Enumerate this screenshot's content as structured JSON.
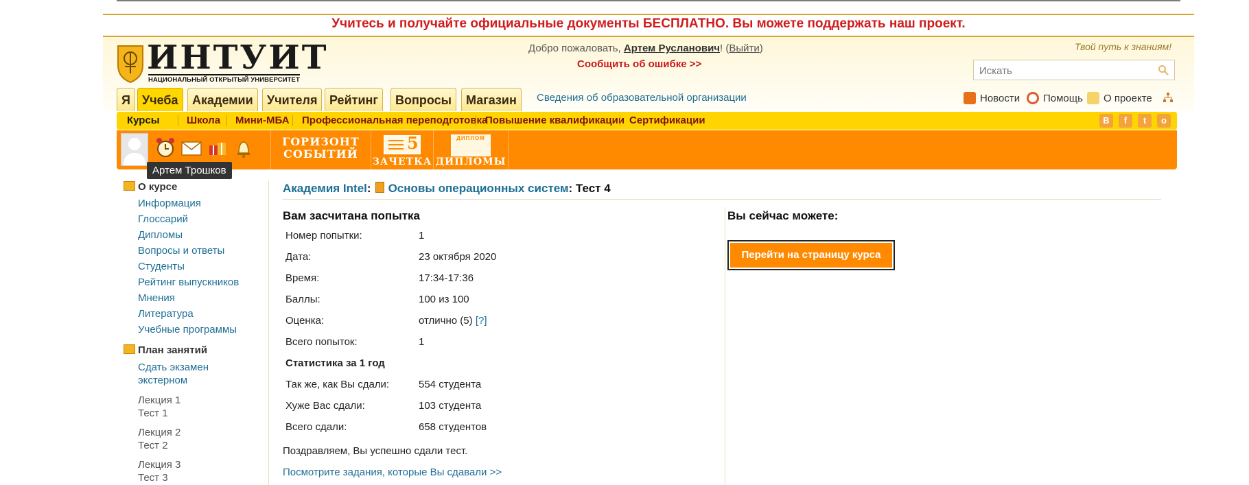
{
  "banner": "Учитесь и получайте официальные документы БЕСПЛАТНО. Вы можете поддержать наш проект.",
  "logo": {
    "title": "ИНТУИТ",
    "subtitle": "НАЦИОНАЛЬНЫЙ ОТКРЫТЫЙ УНИВЕРСИТЕТ"
  },
  "header": {
    "welcome_prefix": "Добро пожаловать,",
    "user_name": "Артем Русланович",
    "excl": "!",
    "logout_label": "Выйти",
    "report_error": "Сообщить об ошибке >>",
    "slogan": "Твой путь к знаниям!",
    "search_placeholder": "Искать"
  },
  "tabs": [
    "Я",
    "Учеба",
    "Академии",
    "Учителя",
    "Рейтинг",
    "Вопросы",
    "Магазин"
  ],
  "active_tab": "Учеба",
  "org_info_link": "Сведения об образовательной организации",
  "top_links": {
    "news": "Новости",
    "help": "Помощь",
    "about": "О проекте"
  },
  "submenu": [
    "Курсы",
    "Школа",
    "Мини-МБА",
    "Профессиональная переподготовка",
    "Повышение квалификации",
    "Сертификации"
  ],
  "social": [
    "В",
    "f",
    "t",
    "о"
  ],
  "promo": {
    "events_line1": "ГОРИЗОНТ",
    "events_line2": "СОБЫТИЙ",
    "gradebook": "ЗАЧЕТКА",
    "gradebook_num": "5",
    "diplomas": "ДИПЛОМЫ",
    "diploma_tag": "ДИПЛОМ"
  },
  "tooltip": "Артем Трошков",
  "sidebar": {
    "about_heading": "О курсе",
    "about_links": [
      "Информация",
      "Глоссарий",
      "Дипломы",
      "Вопросы и ответы",
      "Студенты",
      "Рейтинг выпускников",
      "Мнения",
      "Литература",
      "Учебные программы"
    ],
    "plan_heading": "План занятий",
    "exam_line1": "Сдать экзамен",
    "exam_line2": "экстерном",
    "lessons": [
      {
        "lecture": "Лекция 1",
        "test": "Тест 1"
      },
      {
        "lecture": "Лекция 2",
        "test": "Тест 2"
      },
      {
        "lecture": "Лекция 3",
        "test": "Тест 3"
      }
    ]
  },
  "breadcrumb": {
    "academy": "Академия Intel",
    "sep": ":",
    "course": "Основы операционных систем",
    "page": ": Тест 4"
  },
  "result": {
    "heading": "Вам засчитана попытка",
    "rows": [
      {
        "label": "Номер попытки:",
        "value": "1"
      },
      {
        "label": "Дата:",
        "value": "23 октября 2020"
      },
      {
        "label": "Время:",
        "value": "17:34-17:36"
      },
      {
        "label": "Баллы:",
        "value": "100 из 100"
      },
      {
        "label": "Оценка:",
        "value": "отлично (5)",
        "help": "[?]"
      },
      {
        "label": "Всего попыток:",
        "value": "1"
      }
    ],
    "stats_heading": "Статистика за 1 год",
    "stats": [
      {
        "label": "Так же, как Вы сдали:",
        "value": "554 студента"
      },
      {
        "label": "Хуже Вас сдали:",
        "value": "103 студента"
      },
      {
        "label": "Всего сдали:",
        "value": "658 студентов"
      }
    ],
    "congrats": "Поздравляем, Вы успешно сдали тест.",
    "view_tasks_link": "Посмотрите задания, которые Вы сдавали >>"
  },
  "actions": {
    "heading": "Вы сейчас можете:",
    "course_page_button": "Перейти на страницу курса"
  },
  "colors": {
    "accent_orange": "#ff8a00",
    "submenu_yellow": "#ffd400",
    "banner_red": "#d01c1c",
    "link_blue": "#1e6e95"
  }
}
